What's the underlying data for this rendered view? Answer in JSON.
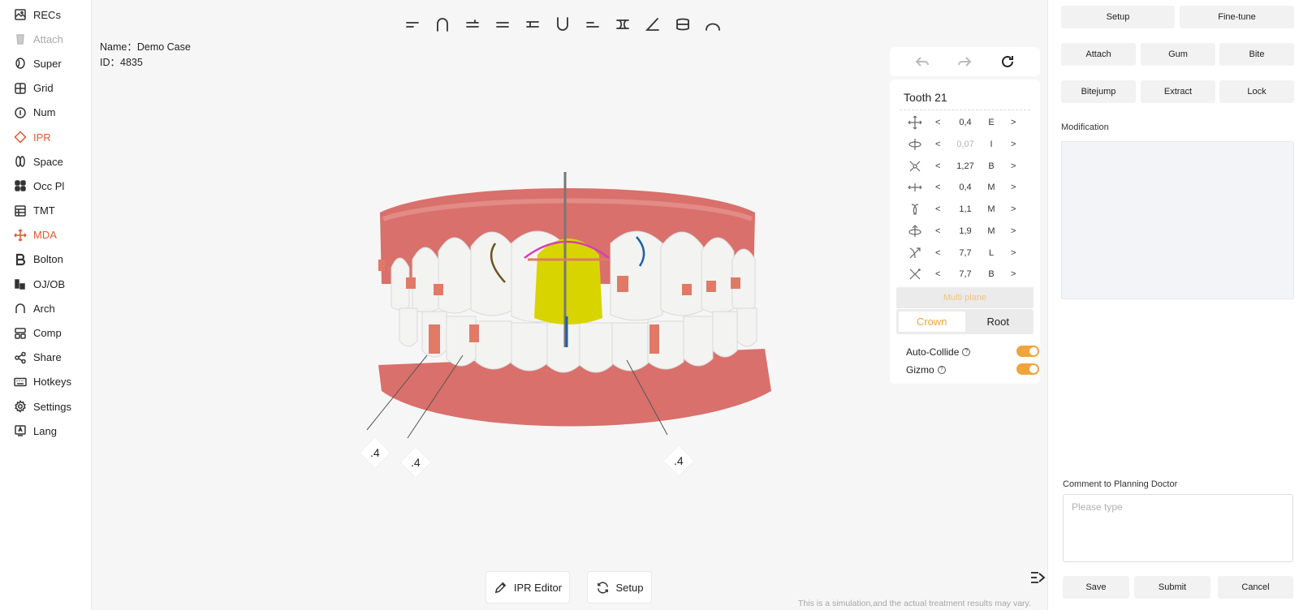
{
  "sidebar": {
    "items": [
      {
        "label": "RECs",
        "icon": "image-icon",
        "state": "normal"
      },
      {
        "label": "Attach",
        "icon": "attach-icon",
        "state": "disabled"
      },
      {
        "label": "Super",
        "icon": "super-icon",
        "state": "normal"
      },
      {
        "label": "Grid",
        "icon": "grid-icon",
        "state": "normal"
      },
      {
        "label": "Num",
        "icon": "num-icon",
        "state": "normal"
      },
      {
        "label": "IPR",
        "icon": "diamond-icon",
        "state": "active"
      },
      {
        "label": "Space",
        "icon": "space-icon",
        "state": "normal"
      },
      {
        "label": "Occ Pl",
        "icon": "occ-plane-icon",
        "state": "normal"
      },
      {
        "label": "TMT",
        "icon": "table-icon",
        "state": "normal"
      },
      {
        "label": "MDA",
        "icon": "move-icon",
        "state": "active"
      },
      {
        "label": "Bolton",
        "icon": "bolton-icon",
        "state": "normal"
      },
      {
        "label": "OJ/OB",
        "icon": "ojob-icon",
        "state": "normal"
      },
      {
        "label": "Arch",
        "icon": "arch-icon",
        "state": "normal"
      },
      {
        "label": "Comp",
        "icon": "compare-icon",
        "state": "normal"
      },
      {
        "label": "Share",
        "icon": "share-icon",
        "state": "normal"
      },
      {
        "label": "Hotkeys",
        "icon": "keyboard-icon",
        "state": "normal"
      },
      {
        "label": "Settings",
        "icon": "gear-icon",
        "state": "normal"
      },
      {
        "label": "Lang",
        "icon": "language-icon",
        "state": "normal"
      }
    ]
  },
  "case": {
    "name_line": "Name：Demo Case",
    "id_line": "ID：4835"
  },
  "view_toolbar": {
    "icons": [
      "upper-occlusal-icon",
      "upper-arch-icon",
      "upper-front-icon",
      "front-view-icon",
      "left-view-icon",
      "lower-arch-icon",
      "lower-front-icon",
      "split-view-icon",
      "angle-view-icon",
      "jaw-view-icon",
      "arch-curve-icon"
    ]
  },
  "ipr_labels": [
    ".4",
    ".4",
    ".4"
  ],
  "bottom": {
    "ipr_editor_label": "IPR Editor",
    "setup_label": "Setup",
    "disclaimer": "This is a simulation,and the actual treatment results may vary."
  },
  "tooth_panel": {
    "title": "Tooth  21",
    "rows": [
      {
        "icon": "translate-icon",
        "value": "0,4",
        "dir": "E",
        "muted": false
      },
      {
        "icon": "rotate-vertical-icon",
        "value": "0,07",
        "dir": "I",
        "muted": true
      },
      {
        "icon": "expand-icon",
        "value": "1,27",
        "dir": "B",
        "muted": false
      },
      {
        "icon": "translate-horizontal-icon",
        "value": "0,4",
        "dir": "M",
        "muted": false
      },
      {
        "icon": "torque-icon",
        "value": "1,1",
        "dir": "M",
        "muted": false
      },
      {
        "icon": "rotation-icon",
        "value": "1,9",
        "dir": "M",
        "muted": false
      },
      {
        "icon": "tip-icon",
        "value": "7,7",
        "dir": "L",
        "muted": false
      },
      {
        "icon": "angulation-icon",
        "value": "7,7",
        "dir": "B",
        "muted": false
      }
    ],
    "prev": "<",
    "next": ">",
    "multi_plane": "Multi plane",
    "crown": "Crown",
    "root": "Root",
    "auto_collide": "Auto-Collide",
    "gizmo": "Gizmo",
    "help": "?"
  },
  "right_panel": {
    "setup": "Setup",
    "fine_tune": "Fine-tune",
    "attach": "Attach",
    "gum": "Gum",
    "bite": "Bite",
    "bitejump": "Bitejump",
    "extract": "Extract",
    "lock": "Lock",
    "modification": "Modification",
    "comment_label": "Comment to Planning Doctor",
    "comment_placeholder": "Please type",
    "save": "Save",
    "submit": "Submit",
    "cancel": "Cancel"
  },
  "colors": {
    "accent": "#f1a43b",
    "active": "#e4572e",
    "gum": "#d9706b",
    "selected_tooth": "#d8d400"
  }
}
